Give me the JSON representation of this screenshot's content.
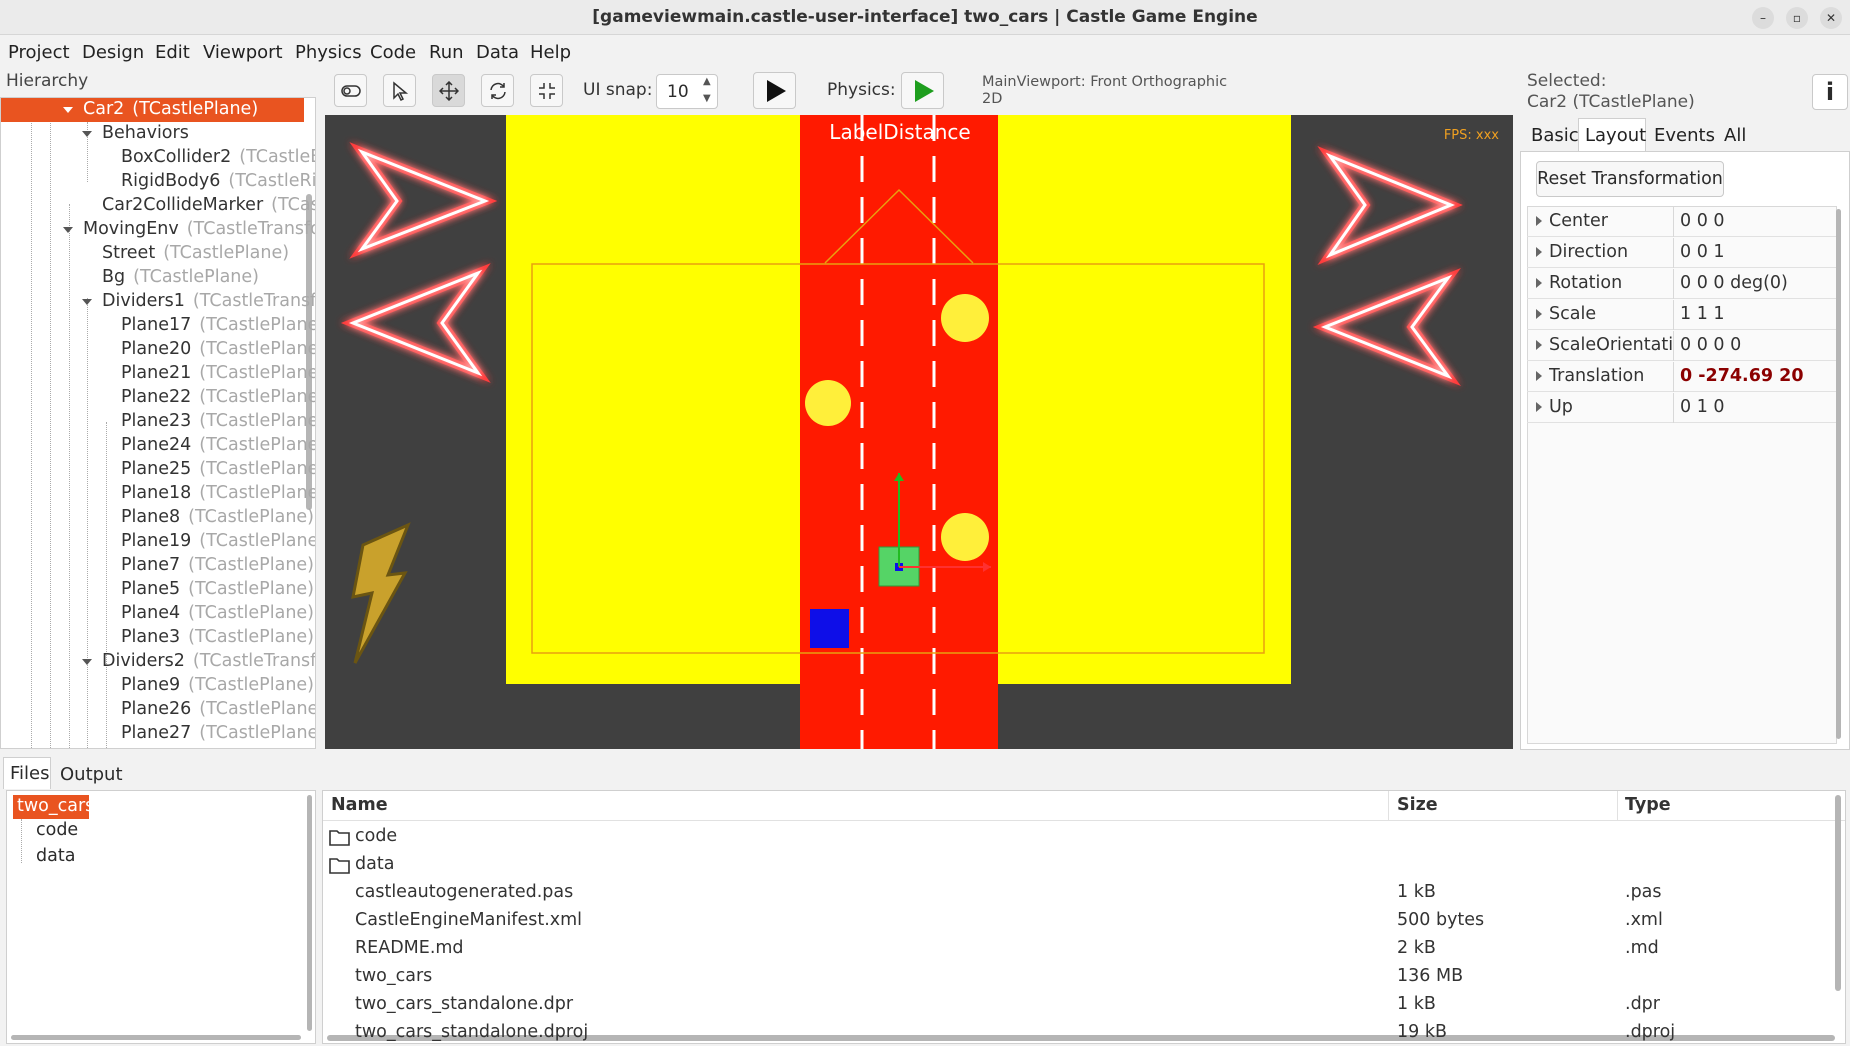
{
  "window": {
    "title": "[gameviewmain.castle-user-interface] two_cars | Castle Game Engine",
    "buttons": [
      "–",
      "▫",
      "✕"
    ]
  },
  "menu": [
    "Project",
    "Design",
    "Edit",
    "Viewport",
    "Physics",
    "Code",
    "Run",
    "Data",
    "Help"
  ],
  "hierarchy": {
    "label": "Hierarchy",
    "items": [
      {
        "name": "Car2",
        "type": "(TCastlePlane)",
        "depth": 3,
        "expanded": true,
        "selected": true
      },
      {
        "name": "Behaviors",
        "type": "",
        "depth": 4,
        "expanded": true
      },
      {
        "name": "BoxCollider2",
        "type": "(TCastleBoxCollider)",
        "depth": 5
      },
      {
        "name": "RigidBody6",
        "type": "(TCastleRigidBody)",
        "depth": 5
      },
      {
        "name": "Car2CollideMarker",
        "type": "(TCastleTransform)",
        "depth": 4
      },
      {
        "name": "MovingEnv",
        "type": "(TCastleTransform)",
        "depth": 3,
        "expanded": true
      },
      {
        "name": "Street",
        "type": "(TCastlePlane)",
        "depth": 4
      },
      {
        "name": "Bg",
        "type": "(TCastlePlane)",
        "depth": 4
      },
      {
        "name": "Dividers1",
        "type": "(TCastleTransform)",
        "depth": 4,
        "expanded": true
      },
      {
        "name": "Plane17",
        "type": "(TCastlePlane)",
        "depth": 5
      },
      {
        "name": "Plane20",
        "type": "(TCastlePlane)",
        "depth": 5
      },
      {
        "name": "Plane21",
        "type": "(TCastlePlane)",
        "depth": 5
      },
      {
        "name": "Plane22",
        "type": "(TCastlePlane)",
        "depth": 5
      },
      {
        "name": "Plane23",
        "type": "(TCastlePlane)",
        "depth": 5
      },
      {
        "name": "Plane24",
        "type": "(TCastlePlane)",
        "depth": 5
      },
      {
        "name": "Plane25",
        "type": "(TCastlePlane)",
        "depth": 5
      },
      {
        "name": "Plane18",
        "type": "(TCastlePlane)",
        "depth": 5
      },
      {
        "name": "Plane8",
        "type": "(TCastlePlane)",
        "depth": 5
      },
      {
        "name": "Plane19",
        "type": "(TCastlePlane)",
        "depth": 5
      },
      {
        "name": "Plane7",
        "type": "(TCastlePlane)",
        "depth": 5
      },
      {
        "name": "Plane5",
        "type": "(TCastlePlane)",
        "depth": 5
      },
      {
        "name": "Plane4",
        "type": "(TCastlePlane)",
        "depth": 5
      },
      {
        "name": "Plane3",
        "type": "(TCastlePlane)",
        "depth": 5
      },
      {
        "name": "Dividers2",
        "type": "(TCastleTransform)",
        "depth": 4,
        "expanded": true
      },
      {
        "name": "Plane9",
        "type": "(TCastlePlane)",
        "depth": 5
      },
      {
        "name": "Plane26",
        "type": "(TCastlePlane)",
        "depth": 5
      },
      {
        "name": "Plane27",
        "type": "(TCastlePlane)",
        "depth": 5
      }
    ]
  },
  "toolbar": {
    "ui_snap_label": "UI snap:",
    "ui_snap_value": "10",
    "physics_label": "Physics:",
    "viewport_info_line1": "MainViewport: Front Orthographic",
    "viewport_info_line2": "2D"
  },
  "viewport": {
    "label_distance": "LabelDistance",
    "fps": "FPS: xxx"
  },
  "inspector": {
    "selected_label": "Selected:",
    "selected_value": "Car2 (TCastlePlane)",
    "info_icon": "i",
    "tabs": [
      "Basic",
      "Layout",
      "Events",
      "All"
    ],
    "active_tab": "Layout",
    "reset_button": "Reset Transformation",
    "properties": [
      {
        "name": "Center",
        "value": "0 0 0"
      },
      {
        "name": "Direction",
        "value": "0 0 1"
      },
      {
        "name": "Rotation",
        "value": "0 0 0 deg(0)"
      },
      {
        "name": "Scale",
        "value": "1 1 1"
      },
      {
        "name": "ScaleOrientation",
        "value": "0 0 0 0"
      },
      {
        "name": "Translation",
        "value": "0 -274.69 20",
        "modified": true
      },
      {
        "name": "Up",
        "value": "0 1 0"
      }
    ]
  },
  "bottom": {
    "tabs": [
      "Files",
      "Output"
    ],
    "active_tab": "Files",
    "tree": [
      {
        "name": "two_cars",
        "selected": true
      },
      {
        "name": "code"
      },
      {
        "name": "data"
      }
    ],
    "columns": {
      "name": "Name",
      "size": "Size",
      "type": "Type"
    },
    "files": [
      {
        "name": "code",
        "size": "",
        "type": "",
        "folder": true
      },
      {
        "name": "data",
        "size": "",
        "type": "",
        "folder": true
      },
      {
        "name": "castleautogenerated.pas",
        "size": "1 kB",
        "type": ".pas"
      },
      {
        "name": "CastleEngineManifest.xml",
        "size": "500 bytes",
        "type": ".xml"
      },
      {
        "name": "README.md",
        "size": "2 kB",
        "type": ".md"
      },
      {
        "name": "two_cars",
        "size": "136 MB",
        "type": ""
      },
      {
        "name": "two_cars_standalone.dpr",
        "size": "1 kB",
        "type": ".dpr"
      },
      {
        "name": "two_cars_standalone.dproj",
        "size": "19 kB",
        "type": ".dproj"
      }
    ]
  },
  "colors": {
    "accent": "#e95420",
    "modified_value": "#8b0000",
    "road": "#ff1a00",
    "background_yellow": "#ffff00",
    "viewport_bg": "#404040",
    "neon": "#ff3b3b"
  }
}
